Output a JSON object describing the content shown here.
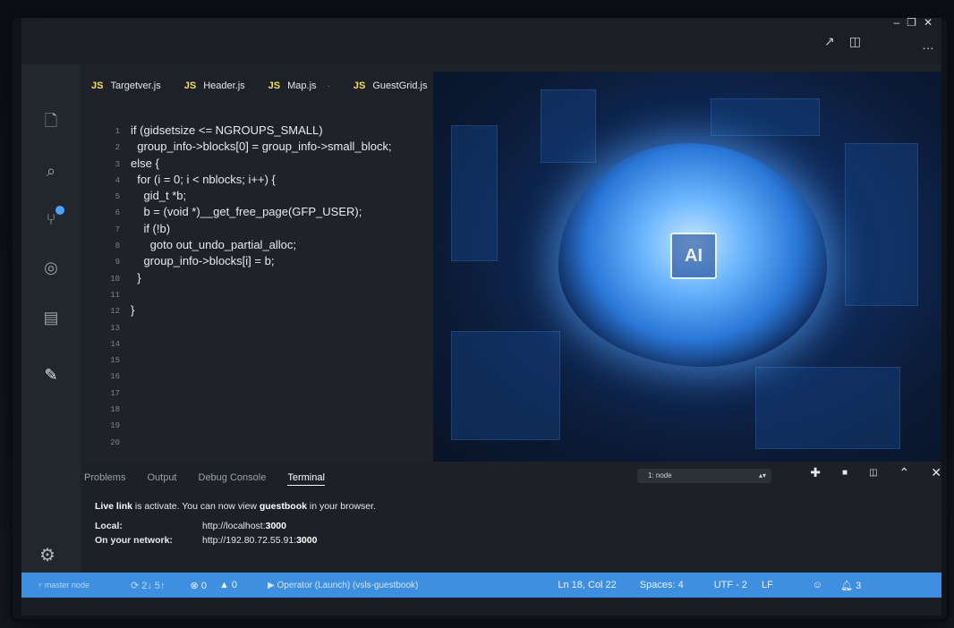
{
  "window": {
    "top_icons": [
      "external-link-icon",
      "split-editor-icon"
    ],
    "controls": [
      "–",
      "❐",
      "✕"
    ],
    "more": "…"
  },
  "tabs": [
    {
      "lang": "JS",
      "name": "Targetver.js"
    },
    {
      "lang": "JS",
      "name": "Header.js"
    },
    {
      "lang": "JS",
      "name": "Map.js",
      "dirty": "·"
    },
    {
      "lang": "JS",
      "name": "GuestGrid.js"
    }
  ],
  "activity": [
    "files-icon",
    "search-icon",
    "source-control-icon",
    "debug-icon",
    "extensions-icon",
    "edit-icon"
  ],
  "editor": {
    "line_numbers": [
      "1",
      "2",
      "3",
      "4",
      "5",
      "6",
      "7",
      "8",
      "9",
      "10",
      "11",
      "12",
      "13",
      "14",
      "15",
      "16",
      "17",
      "18",
      "19",
      "20"
    ],
    "lines": [
      "if (gidsetsize <= NGROUPS_SMALL)",
      "  group_info->blocks[0] = group_info->small_block;",
      "else {",
      "  for (i = 0; i < nblocks; i++) {",
      "    gid_t *b;",
      "    b = (void *)__get_free_page(GFP_USER);",
      "    if (!b)",
      "      goto out_undo_partial_alloc;",
      "    group_info->blocks[i] = b;",
      "  }",
      "",
      "}"
    ]
  },
  "image": {
    "chip_text": "AI"
  },
  "panel": {
    "tabs": [
      "Problems",
      "Output",
      "Debug Console",
      "Terminal"
    ],
    "active_tab": "Terminal",
    "terminal_select": "1: node",
    "terminal": {
      "line1_a": "Live link",
      "line1_b": " is activate. You can now view ",
      "line1_c": "guestbook",
      "line1_d": " in your browser.",
      "local_label": "Local:",
      "local_url_a": "http://localhost:",
      "local_url_b": "3000",
      "network_label": "On your network:",
      "network_url_a": "http://192.80.72.55.91:",
      "network_url_b": "3000"
    }
  },
  "statusbar": {
    "branch": "master node",
    "sync": "2↓ 5↑",
    "errors": "0",
    "warnings": "0",
    "launch": "Operator (Launch)",
    "folder": "(vsls-guestbook)",
    "cursor": "Ln 18, Col 22",
    "spaces": "Spaces: 4",
    "encoding": "UTF - 2",
    "eol": "LF",
    "notifications": "3"
  }
}
